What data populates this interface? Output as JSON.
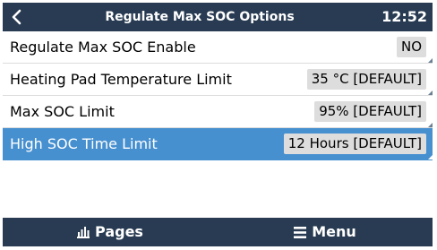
{
  "header": {
    "title": "Regulate Max SOC Options",
    "clock": "12:52"
  },
  "items": [
    {
      "label": "Regulate Max SOC Enable",
      "value": "NO",
      "selected": false
    },
    {
      "label": "Heating Pad Temperature Limit",
      "value": "35 °C [DEFAULT]",
      "selected": false
    },
    {
      "label": "Max SOC Limit",
      "value": "95% [DEFAULT]",
      "selected": false
    },
    {
      "label": "High SOC Time Limit",
      "value": "12 Hours [DEFAULT]",
      "selected": true
    }
  ],
  "footer": {
    "pages_label": "Pages",
    "menu_label": "Menu"
  },
  "colors": {
    "header_bg": "#283b52",
    "selected_bg": "#4790d0",
    "value_bg": "#dddddd"
  },
  "icons": {
    "back": "chevron-left-icon",
    "pages": "bar-chart-icon",
    "menu": "hamburger-menu-icon"
  }
}
